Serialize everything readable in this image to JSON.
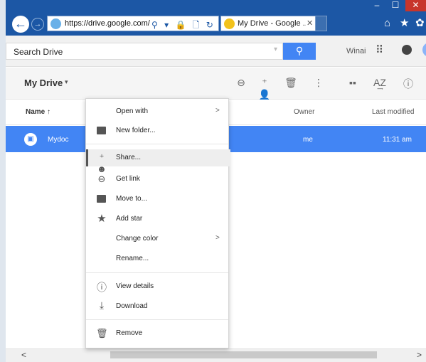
{
  "browser": {
    "window_controls": {
      "minimize": "–",
      "maximize": "☐",
      "close": "✕"
    },
    "back_glyph": "←",
    "forward_glyph": "→",
    "address": "https://drive.google.com/drive/r",
    "address_tools": "⚲ ▾ 🔒 🗋 ↻",
    "tab_title": "My Drive - Google ...",
    "tab_close": "✕",
    "home_icon": "⌂",
    "star_icon": "★",
    "gear_icon": "✿"
  },
  "drive": {
    "search": {
      "label": "Search Drive",
      "caret": "▾",
      "button": "⚲"
    },
    "account_label": "Winai",
    "apps_icon": "⠿",
    "toolbar": {
      "title": "My Drive",
      "title_caret": "▾",
      "icons": [
        "link-icon",
        "add-person-icon",
        "trash-icon",
        "more-vert-icon",
        "grid-view-icon",
        "sort-az-icon",
        "info-icon"
      ],
      "icon_glyphs": [
        "⊖",
        "⁺👤",
        "🗑",
        "⋮",
        "▪▪",
        "A͢Z",
        "ⓘ"
      ]
    },
    "columns": {
      "name": "Name ↑",
      "owner": "Owner",
      "modified": "Last modified"
    },
    "rows": [
      {
        "name": "Mydoc",
        "owner": "me",
        "modified": "11:31 am",
        "icon": "shared-folder-icon",
        "selected": true
      }
    ],
    "scrollbar": {
      "left": "<",
      "right": ">"
    }
  },
  "context_menu": {
    "groups": [
      [
        {
          "label": "Open with",
          "icon": "",
          "submenu": true
        },
        {
          "label": "New folder...",
          "icon": "new-folder-icon",
          "submenu": false
        }
      ],
      [
        {
          "label": "Share...",
          "icon": "share-person-icon",
          "submenu": false,
          "highlighted": true
        },
        {
          "label": "Get link",
          "icon": "link-icon",
          "submenu": false
        },
        {
          "label": "Move to...",
          "icon": "folder-icon",
          "submenu": false
        },
        {
          "label": "Add star",
          "icon": "star-icon",
          "submenu": false
        },
        {
          "label": "Change color",
          "icon": "",
          "submenu": true
        },
        {
          "label": "Rename...",
          "icon": "",
          "submenu": false
        }
      ],
      [
        {
          "label": "View details",
          "icon": "info-icon",
          "submenu": false
        },
        {
          "label": "Download",
          "icon": "download-icon",
          "submenu": false
        }
      ],
      [
        {
          "label": "Remove",
          "icon": "trash-icon",
          "submenu": false
        }
      ]
    ],
    "submenu_glyph": ">"
  }
}
